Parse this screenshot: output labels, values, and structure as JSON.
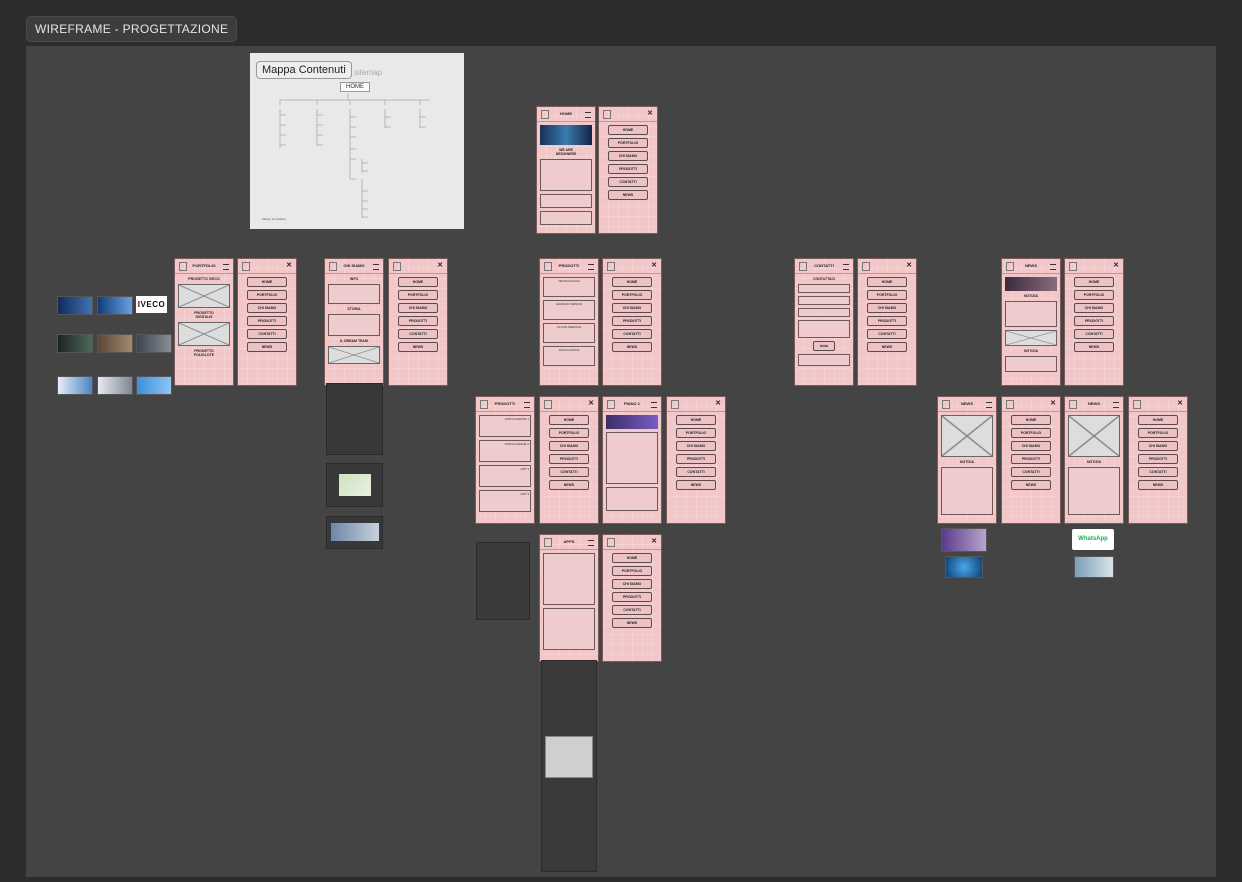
{
  "frame": {
    "label": "WIREFRAME - PROGETTAZIONE"
  },
  "sitemap": {
    "title": "Mappa Contenuti",
    "ghost": "sitemap",
    "home": "HOME",
    "signature": "Manyo & Creative"
  },
  "menu": [
    "HOME",
    "PORTFOLIO",
    "CHI SIAMO",
    "PRODOTTI",
    "CONTATTI",
    "NEWS"
  ],
  "pages": {
    "home": {
      "title": "HOME",
      "headline": "WE ARE\nDESIGNERS"
    },
    "portfolio": {
      "title": "PORTFOLIO",
      "items": [
        "PROGETTO IVECO",
        "PROGETTO\nDIGITALIS",
        "PROGETTO\nPOLIGLOTE"
      ]
    },
    "chisiamo": {
      "title": "CHI SIAMO",
      "sections": [
        "INFO",
        "STORIA",
        "IL DREAM TEAM"
      ]
    },
    "prodotti": {
      "title": "PRODOTTI",
      "items": [
        "TECNOLOGICA",
        "GRAPHIC DESIGN",
        "CLOUD SERVICE",
        "APPLICAZIONI"
      ]
    },
    "contatti": {
      "title": "CONTATTI",
      "form": "CONTATTACI",
      "send": "Invia"
    },
    "news": {
      "title": "NEWS",
      "items": [
        "NOTIZIA",
        "NOTIZIA"
      ]
    },
    "prodotti2": {
      "title": "PRODOTTI",
      "items": [
        "APPLICAZIONE 1",
        "APPLICAZIONE 2",
        "APP 3",
        "APP 3"
      ]
    },
    "piano": {
      "title": "PIANO 1"
    },
    "apps": {
      "title": "APPS"
    },
    "notizia": {
      "title": "NEWS",
      "label": "NOTIZIA"
    }
  },
  "logos": {
    "iveco": "IVECO",
    "whatsapp": "WhatsApp"
  },
  "colors": {
    "canvas": "#2c2c2c",
    "board": "#444444",
    "wireframe": "#f3c6c8"
  }
}
